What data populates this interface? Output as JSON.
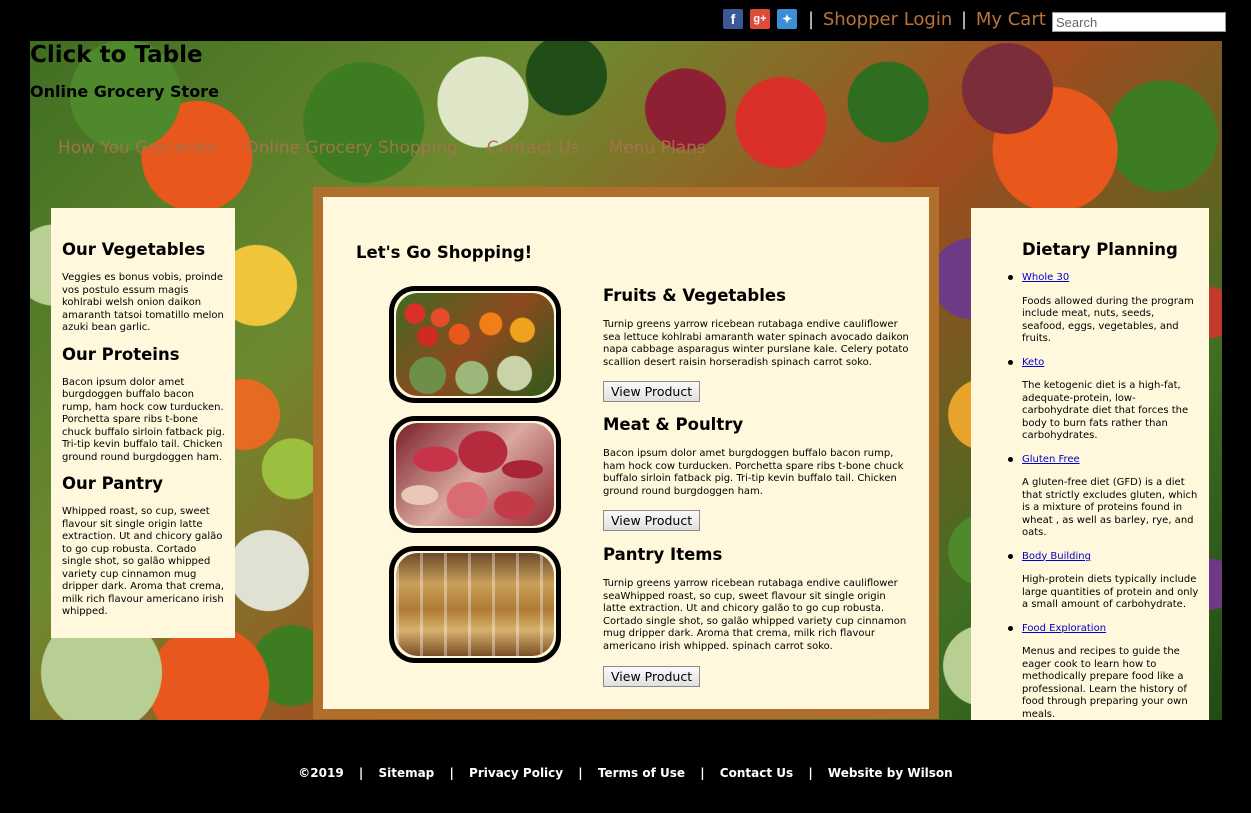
{
  "header": {
    "social": [
      "facebook-icon",
      "google-plus-icon",
      "twitter-icon"
    ],
    "shopper_login": "Shopper Login",
    "my_cart": "My Cart",
    "search_placeholder": "Search"
  },
  "brand": {
    "title": "Click to Table",
    "subtitle": "Online Grocery Store"
  },
  "nav": [
    "How You Groceries",
    "Online Grocery Shopping",
    "Contact Us",
    "Menu Plans"
  ],
  "left_panel": {
    "sections": [
      {
        "title": "Our Vegetables",
        "text": "Veggies es bonus vobis, proinde vos postulo essum magis kohlrabi welsh onion daikon amaranth tatsoi tomatillo melon azuki bean garlic."
      },
      {
        "title": "Our Proteins",
        "text": "Bacon ipsum dolor amet burgdoggen buffalo bacon rump, ham hock cow turducken. Porchetta spare ribs t-bone chuck buffalo sirloin fatback pig. Tri-tip kevin buffalo tail. Chicken ground round burgdoggen ham."
      },
      {
        "title": "Our Pantry",
        "text": "Whipped roast, so cup, sweet flavour sit single origin latte extraction. Ut and chicory galão to go cup robusta. Cortado single shot, so galão whipped variety cup cinnamon mug dripper dark. Aroma that crema, milk rich flavour americano irish whipped."
      }
    ]
  },
  "main": {
    "heading": "Let's Go Shopping!",
    "products": [
      {
        "title": "Fruits & Vegetables",
        "desc": "Turnip greens yarrow ricebean rutabaga endive cauliflower sea lettuce kohlrabi amaranth water spinach avocado daikon napa cabbage asparagus winter purslane kale. Celery potato scallion desert raisin horseradish spinach carrot soko.",
        "button": "View Product"
      },
      {
        "title": "Meat & Poultry",
        "desc": "Bacon ipsum dolor amet burgdoggen buffalo bacon rump, ham hock cow turducken. Porchetta spare ribs t-bone chuck buffalo sirloin fatback pig. Tri-tip kevin buffalo tail. Chicken ground round burgdoggen ham.",
        "button": "View Product"
      },
      {
        "title": "Pantry Items",
        "desc": "Turnip greens yarrow ricebean rutabaga endive cauliflower seaWhipped roast, so cup, sweet flavour sit single origin latte extraction. Ut and chicory galão to go cup robusta. Cortado single shot, so galão whipped variety cup cinnamon mug dripper dark. Aroma that crema, milk rich flavour americano irish whipped. spinach carrot soko.",
        "button": "View Product"
      }
    ]
  },
  "right_panel": {
    "title": "Dietary Planning",
    "items": [
      {
        "link": "Whole 30",
        "desc": "Foods allowed during the program include meat, nuts, seeds, seafood, eggs, vegetables, and fruits."
      },
      {
        "link": "Keto",
        "desc": "The ketogenic diet is a high-fat, adequate-protein, low-carbohydrate diet that forces the body to burn fats rather than carbohydrates."
      },
      {
        "link": "Gluten Free",
        "desc": "A gluten-free diet (GFD) is a diet that strictly excludes gluten, which is a mixture of proteins found in wheat , as well as barley, rye, and oats."
      },
      {
        "link": "Body Building",
        "desc": "High-protein diets typically include large quantities of protein and only a small amount of carbohydrate."
      },
      {
        "link": "Food Exploration",
        "desc": "Menus and recipes to guide the eager cook to learn how to methodically prepare food like a professional. Learn the history of food through preparing your own meals."
      }
    ]
  },
  "footer": {
    "copyright": "©2019",
    "links": [
      "Sitemap",
      "Privacy Policy",
      "Terms of Use",
      "Contact Us",
      "Website by Wilson"
    ]
  }
}
